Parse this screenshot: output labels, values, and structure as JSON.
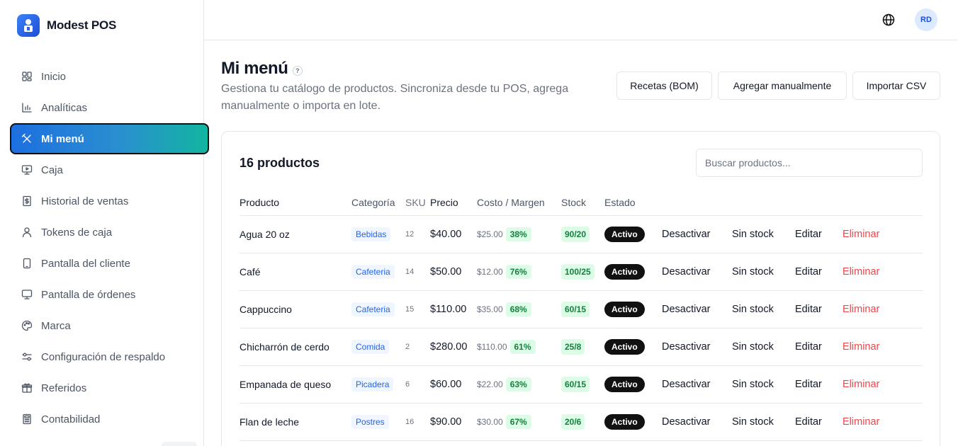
{
  "app": {
    "name": "Modest POS",
    "avatar_initials": "RD"
  },
  "sidebar": {
    "items": [
      {
        "label": "Inicio",
        "icon": "grid-icon",
        "active": false
      },
      {
        "label": "Analíticas",
        "icon": "bar-chart-icon",
        "active": false
      },
      {
        "label": "Mi menú",
        "icon": "utensils-icon",
        "active": true
      },
      {
        "label": "Caja",
        "icon": "monitor-play-icon",
        "active": false
      },
      {
        "label": "Historial de ventas",
        "icon": "receipt-icon",
        "active": false
      },
      {
        "label": "Tokens de caja",
        "icon": "user-icon",
        "active": false
      },
      {
        "label": "Pantalla del cliente",
        "icon": "tablet-icon",
        "active": false
      },
      {
        "label": "Pantalla de órdenes",
        "icon": "monitor-icon",
        "active": false
      },
      {
        "label": "Marca",
        "icon": "palette-icon",
        "active": false
      },
      {
        "label": "Configuración de respaldo",
        "icon": "sliders-icon",
        "active": false
      },
      {
        "label": "Referidos",
        "icon": "gift-icon",
        "active": false
      },
      {
        "label": "Contabilidad",
        "icon": "calculator-icon",
        "active": false
      }
    ]
  },
  "header": {
    "title": "Mi menú",
    "help": "?",
    "description": "Gestiona tu catálogo de productos. Sincroniza desde tu POS, agrega manualmente o importa en lote.",
    "buttons": {
      "recipes": "Recetas (BOM)",
      "add_manual": "Agregar manualmente",
      "import_csv": "Importar CSV"
    }
  },
  "products": {
    "count_label": "16 productos",
    "search_placeholder": "Buscar productos...",
    "columns": [
      "Producto",
      "Categoría",
      "SKU",
      "Precio",
      "Costo / Margen",
      "Stock",
      "Estado"
    ],
    "actions": {
      "deactivate": "Desactivar",
      "no_stock": "Sin stock",
      "edit": "Editar",
      "delete": "Eliminar"
    },
    "rows": [
      {
        "name": "Agua 20 oz",
        "category": "Bebidas",
        "sku": "12",
        "price": "$40.00",
        "cost": "$25.00",
        "margin": "38%",
        "stock": "90/20",
        "status": "Activo"
      },
      {
        "name": "Café",
        "category": "Cafeteria",
        "sku": "14",
        "price": "$50.00",
        "cost": "$12.00",
        "margin": "76%",
        "stock": "100/25",
        "status": "Activo"
      },
      {
        "name": "Cappuccino",
        "category": "Cafeteria",
        "sku": "15",
        "price": "$110.00",
        "cost": "$35.00",
        "margin": "68%",
        "stock": "60/15",
        "status": "Activo"
      },
      {
        "name": "Chicharrón de cerdo",
        "category": "Comida",
        "sku": "2",
        "price": "$280.00",
        "cost": "$110.00",
        "margin": "61%",
        "stock": "25/8",
        "status": "Activo"
      },
      {
        "name": "Empanada de queso",
        "category": "Picadera",
        "sku": "6",
        "price": "$60.00",
        "cost": "$22.00",
        "margin": "63%",
        "stock": "60/15",
        "status": "Activo"
      },
      {
        "name": "Flan de leche",
        "category": "Postres",
        "sku": "16",
        "price": "$90.00",
        "cost": "$30.00",
        "margin": "67%",
        "stock": "20/6",
        "status": "Activo"
      }
    ]
  }
}
